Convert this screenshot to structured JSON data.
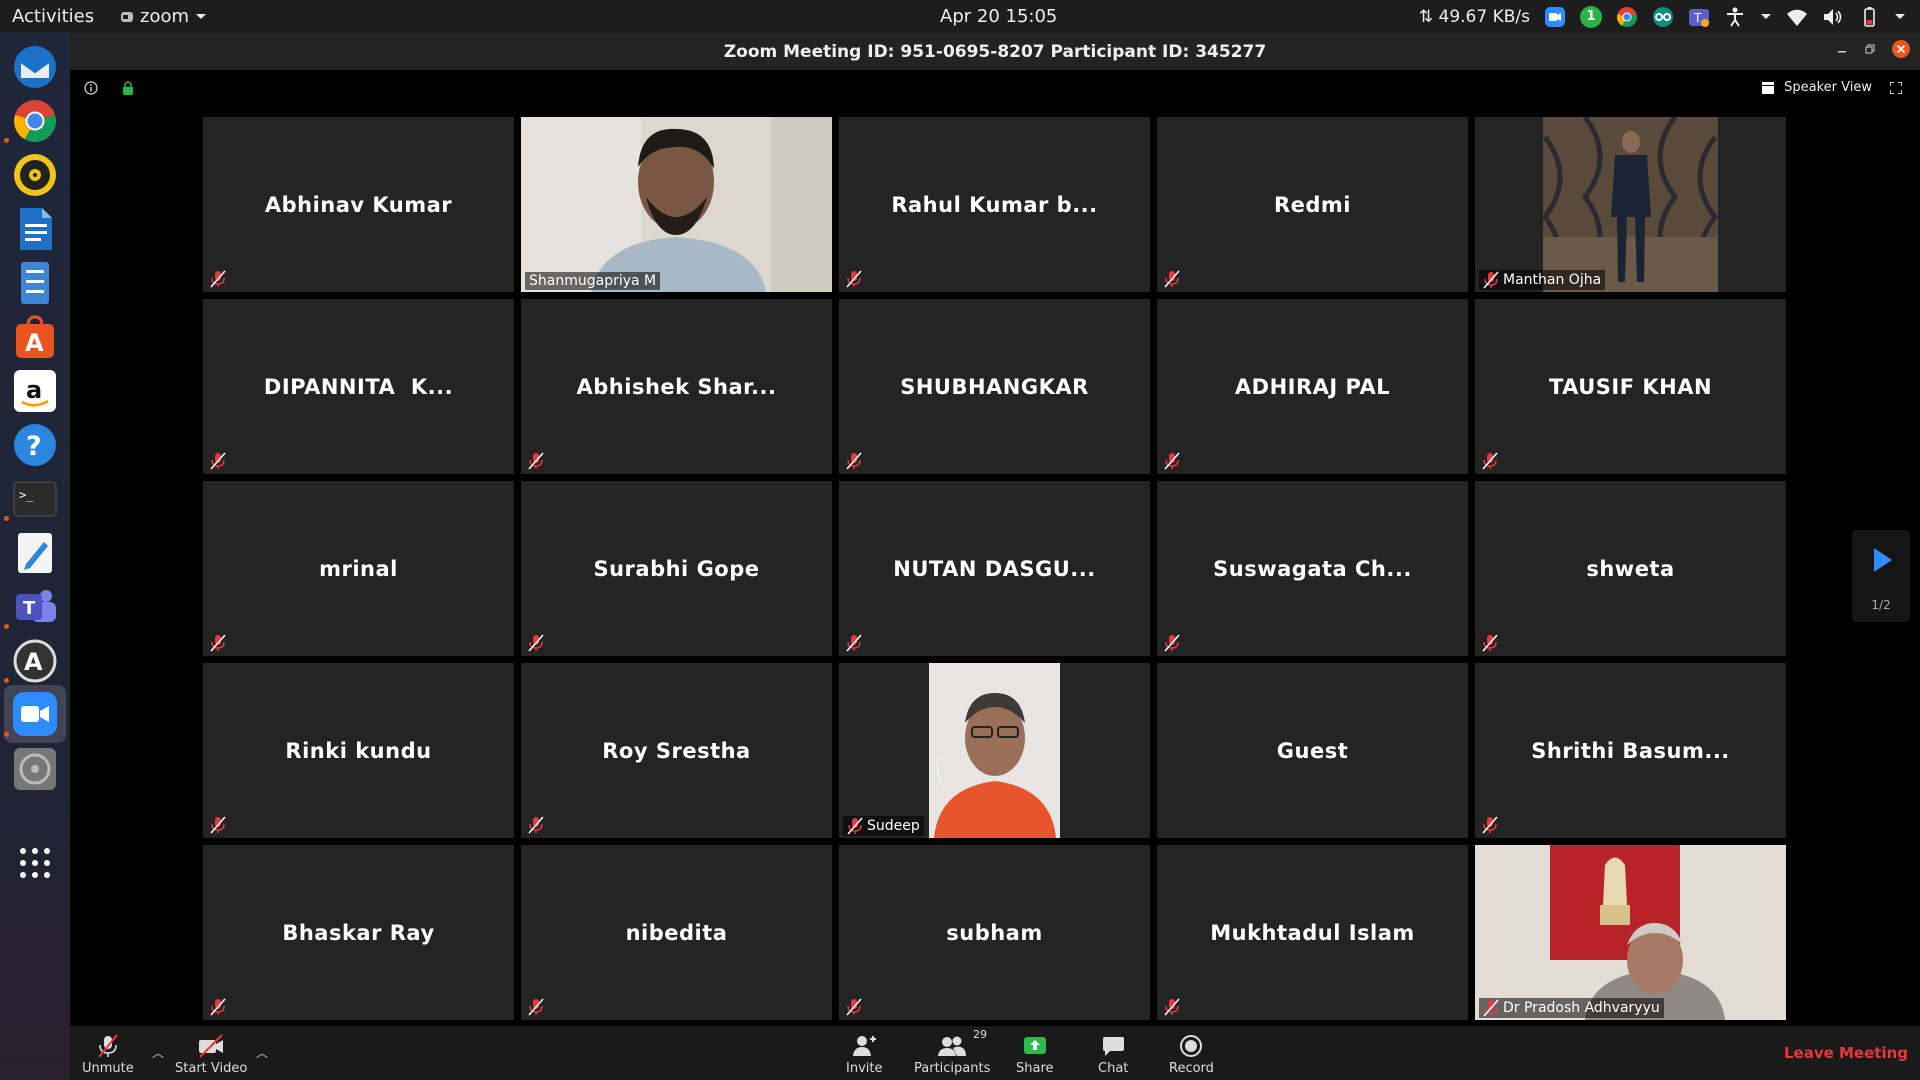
{
  "topbar": {
    "activities": "Activities",
    "app_name": "zoom",
    "clock": "Apr 20  15:05",
    "net_speed": "⇅ 49.67 KB/s",
    "notif_count": "1"
  },
  "window": {
    "title": "Zoom Meeting ID: 951-0695-8207 Participant ID: 345277"
  },
  "view": {
    "speaker_view_label": "Speaker View",
    "page_indicator": "1/2"
  },
  "participants": [
    {
      "name": "Abhinav Kumar",
      "video": false,
      "muted": true
    },
    {
      "name": "Shanmugapriya M",
      "video": true,
      "muted": false,
      "active": true
    },
    {
      "name": "Rahul Kumar b...",
      "video": false,
      "muted": true
    },
    {
      "name": "Redmi",
      "video": false,
      "muted": true
    },
    {
      "name": "Manthan Ojha",
      "video": true,
      "muted": true
    },
    {
      "name": "DIPANNITA  K...",
      "video": false,
      "muted": true
    },
    {
      "name": "Abhishek Shar...",
      "video": false,
      "muted": true
    },
    {
      "name": "SHUBHANGKAR",
      "video": false,
      "muted": true
    },
    {
      "name": "ADHIRAJ PAL",
      "video": false,
      "muted": true
    },
    {
      "name": "TAUSIF KHAN",
      "video": false,
      "muted": true
    },
    {
      "name": "mrinal",
      "video": false,
      "muted": true
    },
    {
      "name": "Surabhi Gope",
      "video": false,
      "muted": true
    },
    {
      "name": "NUTAN DASGU...",
      "video": false,
      "muted": true
    },
    {
      "name": "Suswagata Ch...",
      "video": false,
      "muted": true
    },
    {
      "name": "shweta",
      "video": false,
      "muted": true
    },
    {
      "name": "Rinki kundu",
      "video": false,
      "muted": true
    },
    {
      "name": "Roy Srestha",
      "video": false,
      "muted": true
    },
    {
      "name": "Sudeep",
      "video": true,
      "muted": true
    },
    {
      "name": "Guest",
      "video": false,
      "muted": false
    },
    {
      "name": "Shrithi Basum...",
      "video": false,
      "muted": true
    },
    {
      "name": "Bhaskar Ray",
      "video": false,
      "muted": true
    },
    {
      "name": "nibedita",
      "video": false,
      "muted": true
    },
    {
      "name": "subham",
      "video": false,
      "muted": true
    },
    {
      "name": "Mukhtadul Islam",
      "video": false,
      "muted": true
    },
    {
      "name": "Dr Pradosh Adhvaryyu",
      "video": true,
      "muted": true
    }
  ],
  "toolbar": {
    "unmute": "Unmute",
    "start_video": "Start Video",
    "invite": "Invite",
    "participants": "Participants",
    "participant_count": "29",
    "share": "Share",
    "chat": "Chat",
    "record": "Record",
    "leave": "Leave Meeting"
  },
  "colors": {
    "active_speaker_border": "#c9e34a",
    "mute_red": "#e8383d",
    "share_green": "#2dbb4e",
    "zoom_blue": "#2d8cff"
  }
}
